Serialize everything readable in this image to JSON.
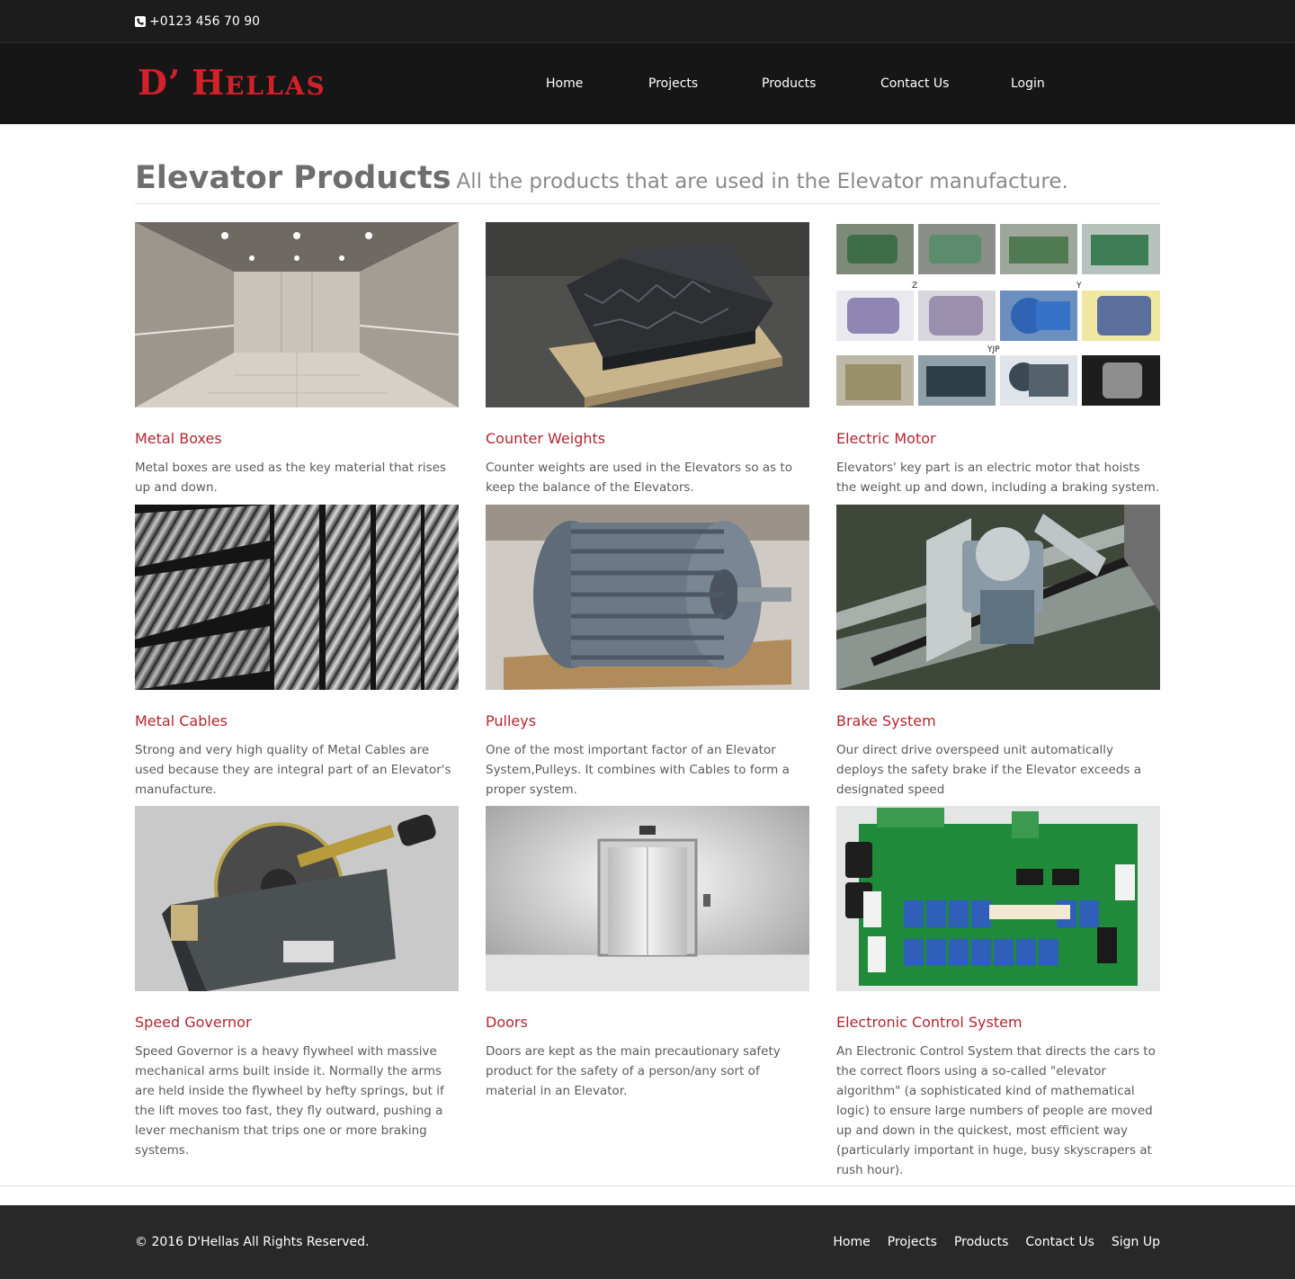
{
  "topbar": {
    "phone": "+0123 456 70 90",
    "phone_icon": "phone-icon"
  },
  "brand": {
    "d": "D",
    "apostrophe": "’",
    "h": "H",
    "rest": "ELLAS",
    "color": "#d3212a"
  },
  "nav": [
    {
      "label": "Home"
    },
    {
      "label": "Projects"
    },
    {
      "label": "Products"
    },
    {
      "label": "Contact Us"
    },
    {
      "label": "Login"
    }
  ],
  "page": {
    "title": "Elevator Products",
    "subtitle": "All the products that are used in the Elevator manufacture."
  },
  "products": [
    {
      "title": "Metal Boxes",
      "description": "Metal boxes are used as the key material that rises up and down.",
      "image": "elevator-cabin-photo"
    },
    {
      "title": "Counter Weights",
      "description": "Counter weights are used in the Elevators so as to keep the balance of the Elevators.",
      "image": "counter-weights-photo"
    },
    {
      "title": "Electric Motor",
      "description": "Elevators' key part is an electric motor that hoists the weight up and down, including a braking system.",
      "image": "electric-motors-collage"
    },
    {
      "title": "Metal Cables",
      "description": "Strong and very high quality of Metal Cables are used because they are integral part of an Elevator's manufacture.",
      "image": "steel-cables-photo"
    },
    {
      "title": "Pulleys",
      "description": "One of the most important factor of an Elevator System,Pulleys. It combines with Cables to form a proper system.",
      "image": "pulley-drum-photo"
    },
    {
      "title": "Brake System",
      "description": "Our direct drive overspeed unit automatically deploys the safety brake if the Elevator exceeds a designated speed",
      "image": "brake-unit-photo"
    },
    {
      "title": "Speed Governor",
      "description": "Speed Governor is a heavy flywheel with massive mechanical arms built inside it. Normally the arms are held inside the flywheel by hefty springs, but if the lift moves too fast, they fly outward, pushing a lever mechanism that trips one or more braking systems.",
      "image": "speed-governor-photo"
    },
    {
      "title": "Doors",
      "description": "Doors are kept as the main precautionary safety product for the safety of a person/any sort of material in an Elevator.",
      "image": "elevator-doors-photo"
    },
    {
      "title": "Electronic Control System",
      "description": "An Electronic Control System that directs the cars to the correct floors using a so-called \"elevator algorithm\" (a sophisticated kind of mathematical logic) to ensure large numbers of people are moved up and down in the quickest, most efficient way (particularly important in huge, busy skyscrapers at rush hour).",
      "image": "control-board-photo"
    }
  ],
  "collage_labels": {
    "z": "Z",
    "y": "Y",
    "yjp": "YJP"
  },
  "footer": {
    "copyright": "© 2016 D'Hellas All Rights Reserved.",
    "links": [
      {
        "label": "Home"
      },
      {
        "label": "Projects"
      },
      {
        "label": "Products"
      },
      {
        "label": "Contact Us"
      },
      {
        "label": "Sign Up"
      }
    ]
  },
  "colors": {
    "accent": "#b3262f",
    "header_bg": "#161616",
    "topbar_bg": "#1c1c1c",
    "footer_bg": "#282828"
  }
}
